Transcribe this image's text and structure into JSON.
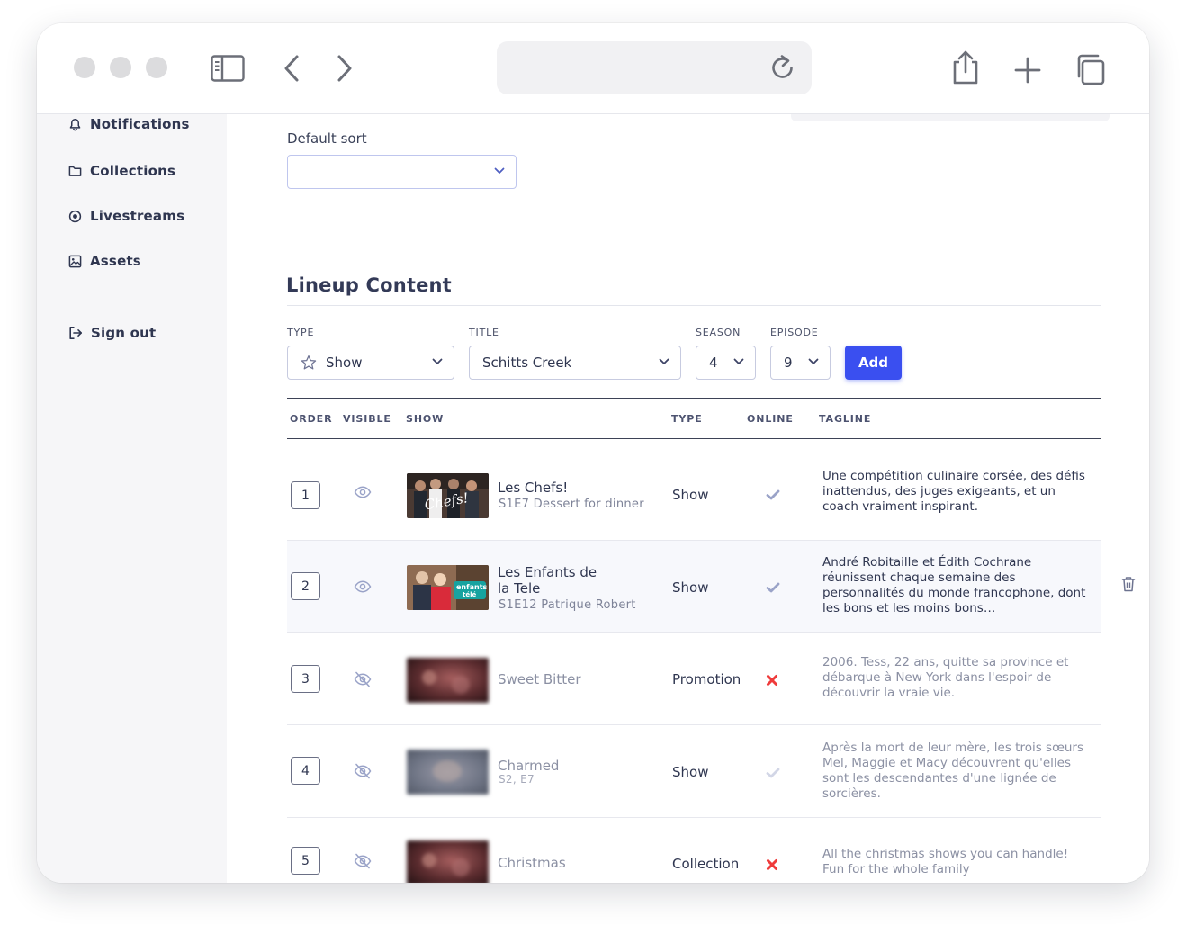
{
  "sidebar": {
    "items": [
      {
        "label": "Notifications",
        "icon": "bell-icon"
      },
      {
        "label": "Collections",
        "icon": "folder-icon"
      },
      {
        "label": "Livestreams",
        "icon": "livestream-icon"
      },
      {
        "label": "Assets",
        "icon": "image-icon"
      }
    ],
    "sign_out": {
      "label": "Sign out",
      "icon": "sign-out-icon"
    }
  },
  "default_sort": {
    "label": "Default sort",
    "value": ""
  },
  "lineup": {
    "title": "Lineup Content",
    "form": {
      "type_label": "TYPE",
      "type_value": "Show",
      "title_label": "TITLE",
      "title_value": "Schitts Creek",
      "season_label": "SEASON",
      "season_value": "4",
      "episode_label": "EPISODE",
      "episode_value": "9",
      "add_label": "Add"
    },
    "columns": [
      "ORDER",
      "VISIBLE",
      "SHOW",
      "TYPE",
      "ONLINE",
      "TAGLINE"
    ],
    "rows": [
      {
        "order": "1",
        "visible": true,
        "title": "Les Chefs!",
        "subtitle": "S1E7 Dessert for dinner",
        "type": "Show",
        "online": true,
        "tagline": "Une compétition culinaire corsée, des défis inattendus, des juges exigeants, et un coach vraiment inspirant."
      },
      {
        "order": "2",
        "visible": true,
        "title": "Les Enfants de la Tele",
        "subtitle": "S1E12 Patrique Robert",
        "type": "Show",
        "online": true,
        "tagline": "André Robitaille et Édith Cochrane réunissent chaque semaine des personnalités du monde francophone, dont les bons et les moins bons…"
      },
      {
        "order": "3",
        "visible": false,
        "title": "Sweet Bitter",
        "subtitle": "",
        "type": "Promotion",
        "online": false,
        "tagline": "2006. Tess, 22 ans, quitte sa province et débarque à New York dans l'espoir de découvrir la vraie vie."
      },
      {
        "order": "4",
        "visible": false,
        "title": "Charmed",
        "subtitle": "S2, E7",
        "type": "Show",
        "online": true,
        "tagline": "Après la mort de leur mère, les trois sœurs Mel, Maggie et Macy découvrent qu'elles sont les descendantes d'une lignée de sorcières."
      },
      {
        "order": "5",
        "visible": false,
        "title": "Christmas",
        "subtitle": "",
        "type": "Collection",
        "online": false,
        "tagline": "All the christmas shows you can handle! Fun for the whole family"
      }
    ]
  },
  "colors": {
    "accent": "#3a4ff0",
    "text": "#2f3650",
    "muted": "#8b90a3",
    "offline": "#ef3b3b",
    "online_check": "#9aa3c8",
    "sidebar_bg": "#f6f6f8"
  }
}
